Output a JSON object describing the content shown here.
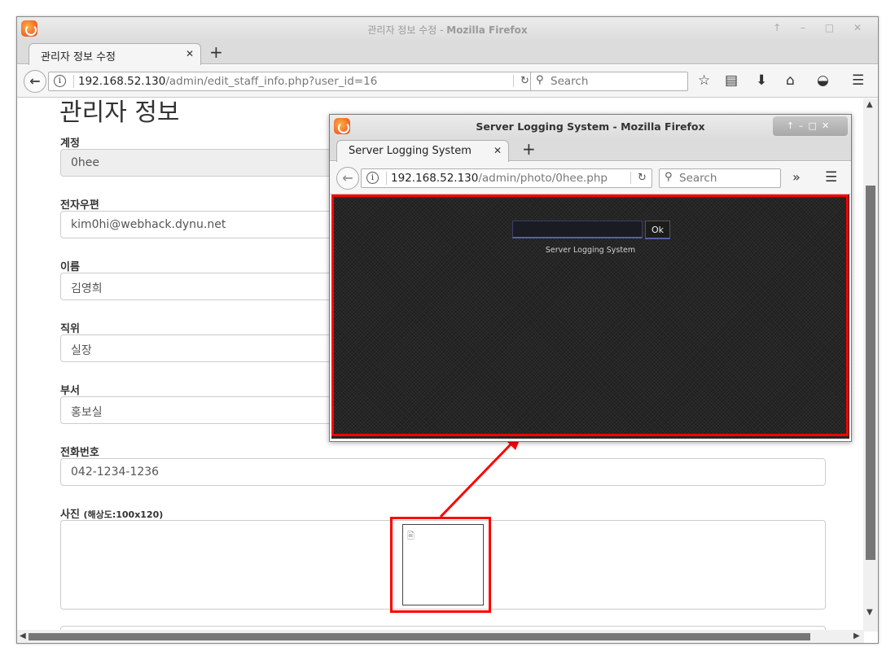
{
  "main_window": {
    "title_prefix": "관리자 정보 수정 - ",
    "title_app": "Mozilla Firefox",
    "tab_label": "관리자 정보 수정",
    "url_host": "192.168.52.130",
    "url_path": "/admin/edit_staff_info.php?user_id=16",
    "search_placeholder": "Search"
  },
  "page": {
    "heading": "관리자 정보",
    "fields": [
      {
        "label": "계정",
        "value": "0hee"
      },
      {
        "label": "전자우편",
        "value": "kim0hi@webhack.dynu.net"
      },
      {
        "label": "이름",
        "value": "김영희"
      },
      {
        "label": "직위",
        "value": "실장"
      },
      {
        "label": "부서",
        "value": "홍보실"
      },
      {
        "label": "전화번호",
        "value": "042-1234-1236"
      }
    ],
    "photo_label": "사진",
    "photo_hint": "(해상도:100x120)"
  },
  "popup_window": {
    "title": "Server Logging System - Mozilla Firefox",
    "tab_label": "Server Logging System",
    "url_host": "192.168.52.130",
    "url_path": "/admin/photo/0hee.php",
    "search_placeholder": "Search",
    "ok_label": "Ok",
    "caption": "Server Logging System"
  },
  "colors": {
    "annotation": "#ff0000",
    "server_bg": "#202020"
  },
  "icons": [
    "firefox-icon",
    "back-arrow-icon",
    "info-icon",
    "reload-icon",
    "search-icon",
    "star-icon",
    "reader-icon",
    "download-icon",
    "home-icon",
    "pocket-icon",
    "menu-icon",
    "overflow-icon",
    "broken-image-icon"
  ]
}
